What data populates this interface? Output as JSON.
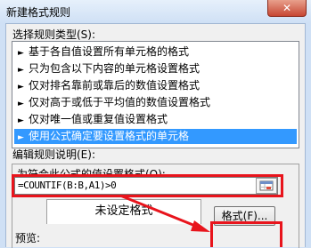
{
  "window": {
    "title": "新建格式规则",
    "close_label": "✕"
  },
  "rule_type": {
    "heading": "选择规则类型(S):",
    "items": [
      {
        "label": "基于各自值设置所有单元格的格式"
      },
      {
        "label": "只为包含以下内容的单元格设置格式"
      },
      {
        "label": "仅对排名靠前或靠后的数值设置格式"
      },
      {
        "label": "仅对高于或低于平均值的数值设置格式"
      },
      {
        "label": "仅对唯一值或重复值设置格式"
      },
      {
        "label": "使用公式确定要设置格式的单元格",
        "selected": true
      }
    ]
  },
  "edit_rule": {
    "heading": "编辑规则说明(E):",
    "formula_label": "为符合此公式的值设置格式(O):",
    "formula_value": "=COUNTIF(B:B,A1)>0",
    "preview_label": "预览:",
    "preview_text": "未设定格式",
    "format_button": "格式(F)..."
  },
  "colors": {
    "selection": "#3399ff",
    "highlight": "#e8141c"
  },
  "icons": {
    "list_bullet": "triangle-right",
    "range_picker": "range-select-icon"
  }
}
